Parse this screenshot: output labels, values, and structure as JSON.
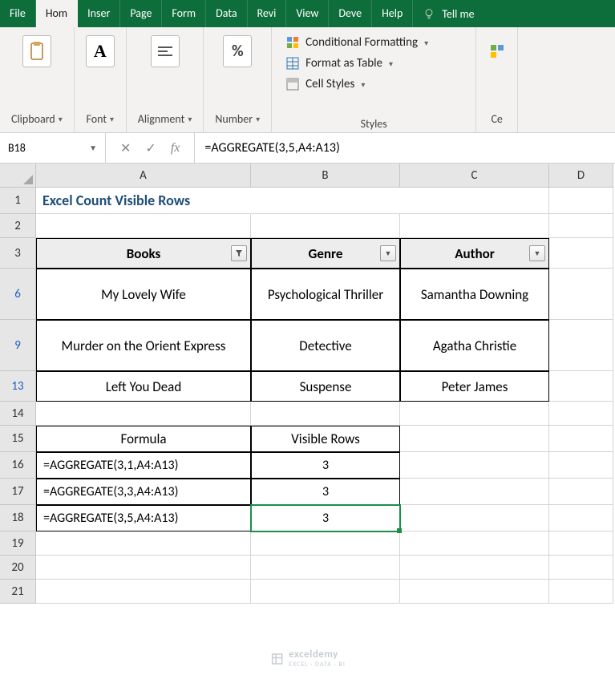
{
  "tabs": {
    "file": "File",
    "home": "Hom",
    "insert": "Inser",
    "page": "Page",
    "formulas": "Form",
    "data": "Data",
    "review": "Revi",
    "view": "View",
    "developer": "Deve",
    "help": "Help",
    "tell_me": "Tell me"
  },
  "groups": {
    "clipboard": "Clipboard",
    "font": "Font",
    "alignment": "Alignment",
    "number": "Number",
    "styles": "Styles",
    "cells": "Ce"
  },
  "styles_menu": {
    "cond_format": "Conditional Formatting",
    "table_format": "Format as Table",
    "cell_styles": "Cell Styles"
  },
  "font_icon": "A",
  "percent_icon": "%",
  "name_box": "B18",
  "formula": "=AGGREGATE(3,5,A4:A13)",
  "columns": [
    "A",
    "B",
    "C",
    "D"
  ],
  "title": "Excel Count Visible Rows",
  "headers": {
    "books": "Books",
    "genre": "Genre",
    "author": "Author"
  },
  "rows": [
    {
      "n": "6",
      "book": "My Lovely Wife",
      "genre": "Psychological Thriller",
      "author": "Samantha Downing"
    },
    {
      "n": "9",
      "book": "Murder on the Orient Express",
      "genre": "Detective",
      "author": "Agatha Christie"
    },
    {
      "n": "13",
      "book": "Left You Dead",
      "genre": "Suspense",
      "author": "Peter James"
    }
  ],
  "section2": {
    "h1": "Formula",
    "h2": "Visible Rows",
    "rows": [
      {
        "n": "16",
        "f": "=AGGREGATE(3,1,A4:A13)",
        "v": "3"
      },
      {
        "n": "17",
        "f": "=AGGREGATE(3,3,A4:A13)",
        "v": "3"
      },
      {
        "n": "18",
        "f": "=AGGREGATE(3,5,A4:A13)",
        "v": "3"
      }
    ]
  },
  "plain_rows": [
    "1",
    "2",
    "3",
    "14",
    "15",
    "19",
    "20",
    "21"
  ],
  "watermark": {
    "main": "exceldemy",
    "sub": "EXCEL · DATA · BI"
  }
}
